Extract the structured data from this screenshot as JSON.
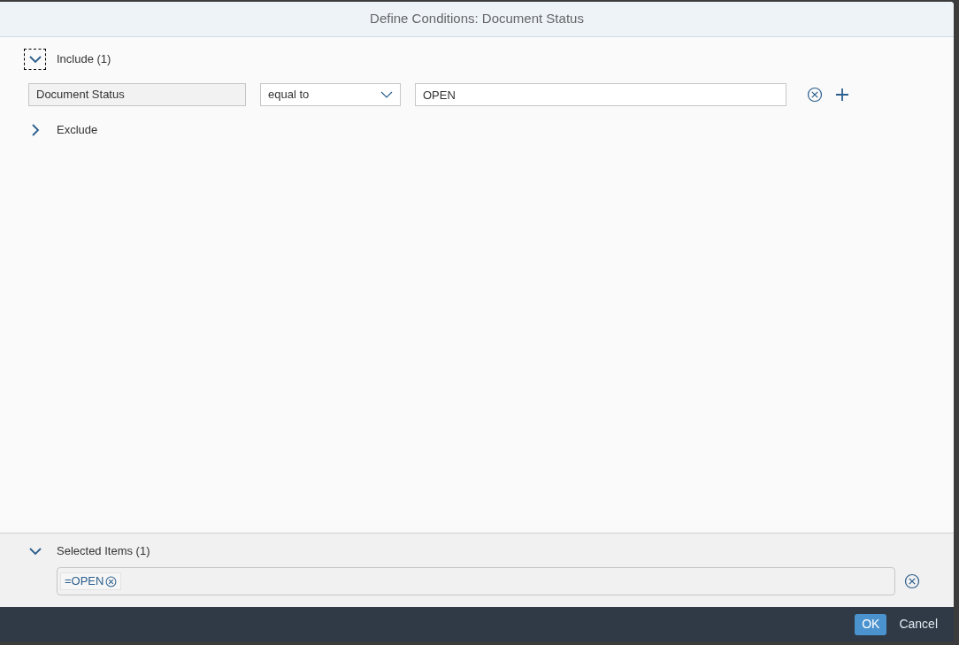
{
  "dialog": {
    "title": "Define Conditions: Document Status"
  },
  "include": {
    "label": "Include (1)",
    "expanded": true,
    "focused": true,
    "conditions": [
      {
        "field": "Document Status",
        "operator": "equal to",
        "value": "OPEN"
      }
    ]
  },
  "exclude": {
    "label": "Exclude",
    "expanded": false,
    "focused": false
  },
  "selected_items": {
    "label": "Selected Items (1)",
    "expanded": true,
    "tokens": [
      "=OPEN"
    ]
  },
  "buttons": [
    {
      "label": "OK",
      "kind": "primary"
    },
    {
      "label": "Cancel",
      "kind": "plain"
    }
  ]
}
